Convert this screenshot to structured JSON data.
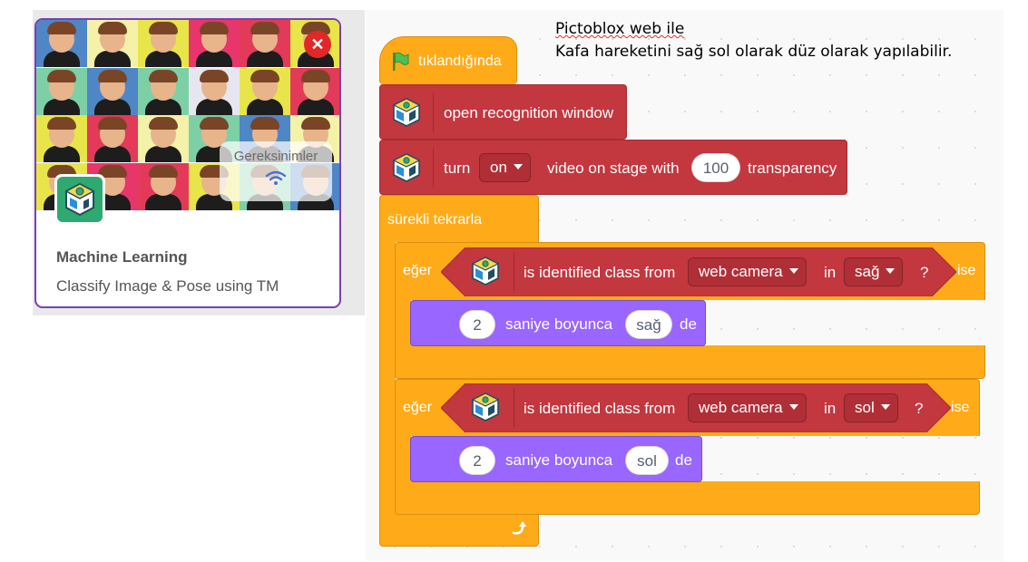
{
  "card": {
    "title": "Machine Learning",
    "subtitle": "Classify Image & Pose using TM",
    "requirements_label": "Gereksinimler",
    "close_icon": "close-icon",
    "requirement_icon": "wifi-icon",
    "border_color": "#7b3fb0"
  },
  "note": {
    "line1": "Pictoblox web ile",
    "line2": "Kafa hareketini sağ sol olarak düz olarak yapılabilir."
  },
  "script": {
    "hat_label": "tıklandığında",
    "hat_icon": "green-flag-icon",
    "open_window_label": "open recognition window",
    "turn_label": "turn",
    "turn_value": "on",
    "video_label": "video on stage with",
    "transparency_value": "100",
    "transparency_label": "transparency",
    "forever_label": "sürekli tekrarla",
    "loop_icon": "loop-arrow-icon",
    "if1": {
      "if_label": "eğer",
      "cond_label": "is identified class from",
      "source_value": "web camera",
      "in_label": "in",
      "class_value": "sağ",
      "qmark": "?",
      "then_label": "ise",
      "say_secs": "2",
      "say_label": "saniye boyunca",
      "say_text": "sağ",
      "say_end": "de"
    },
    "if2": {
      "if_label": "eğer",
      "cond_label": "is identified class from",
      "source_value": "web camera",
      "in_label": "in",
      "class_value": "sol",
      "qmark": "?",
      "then_label": "ise",
      "say_secs": "2",
      "say_label": "saniye boyunca",
      "say_text": "sol",
      "say_end": "de"
    }
  },
  "colors": {
    "control": "#ffab19",
    "extension": "#c3373f",
    "looks": "#9966ff",
    "extension_logo": "#2ea96f"
  }
}
